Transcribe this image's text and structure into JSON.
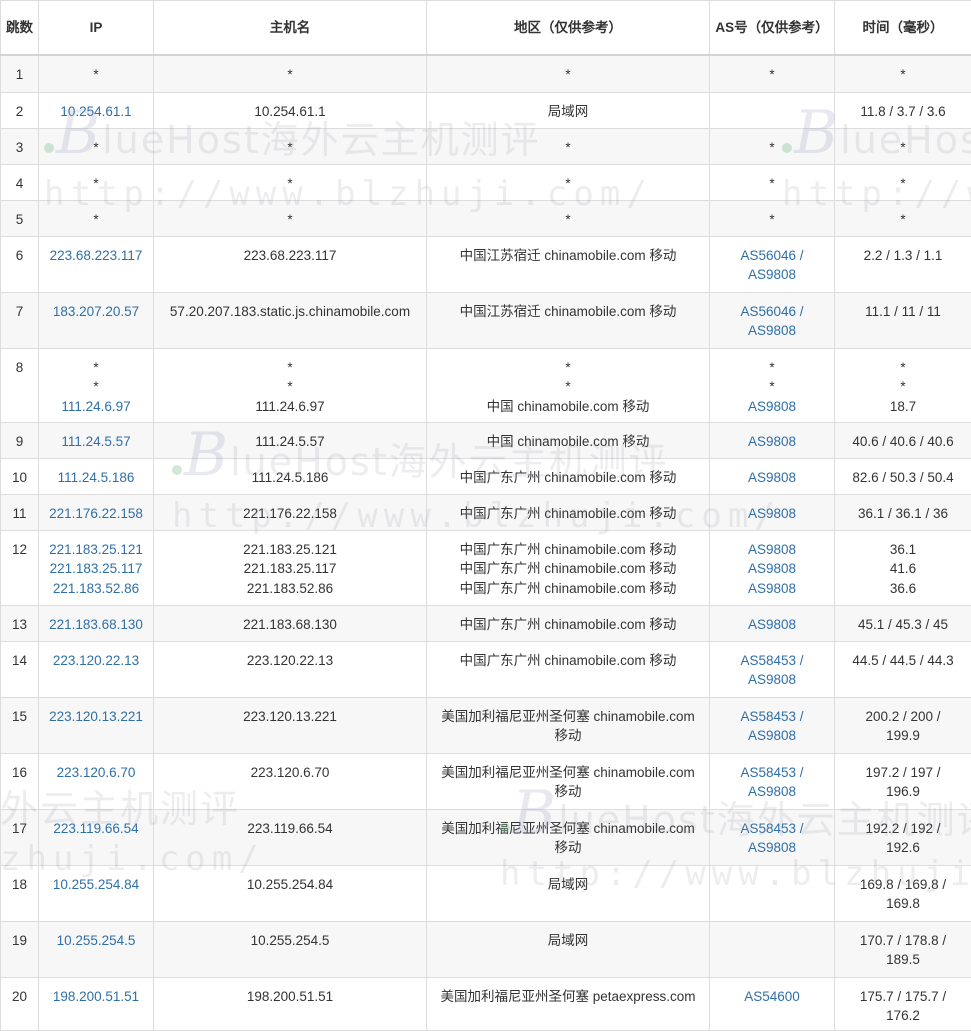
{
  "headers": {
    "hop": "跳数",
    "ip": "IP",
    "host": "主机名",
    "region": "地区（仅供参考）",
    "as": "AS号（仅供参考）",
    "time": "时间（毫秒）"
  },
  "rows": [
    {
      "hop": "1",
      "ips": [
        "*"
      ],
      "hosts": [
        "*"
      ],
      "regions": [
        "*"
      ],
      "as": [
        "*"
      ],
      "times": [
        "*"
      ]
    },
    {
      "hop": "2",
      "ips": [
        "10.254.61.1"
      ],
      "hosts": [
        "10.254.61.1"
      ],
      "regions": [
        "局域网"
      ],
      "as": [
        ""
      ],
      "times": [
        "11.8 / 3.7 / 3.6"
      ]
    },
    {
      "hop": "3",
      "ips": [
        "*"
      ],
      "hosts": [
        "*"
      ],
      "regions": [
        "*"
      ],
      "as": [
        "*"
      ],
      "times": [
        "*"
      ]
    },
    {
      "hop": "4",
      "ips": [
        "*"
      ],
      "hosts": [
        "*"
      ],
      "regions": [
        "*"
      ],
      "as": [
        "*"
      ],
      "times": [
        "*"
      ]
    },
    {
      "hop": "5",
      "ips": [
        "*"
      ],
      "hosts": [
        "*"
      ],
      "regions": [
        "*"
      ],
      "as": [
        "*"
      ],
      "times": [
        "*"
      ]
    },
    {
      "hop": "6",
      "ips": [
        "223.68.223.117"
      ],
      "hosts": [
        "223.68.223.117"
      ],
      "regions": [
        "中国江苏宿迁 chinamobile.com 移动"
      ],
      "as": [
        "AS56046 /",
        "AS9808"
      ],
      "times": [
        "2.2 / 1.3 / 1.1"
      ]
    },
    {
      "hop": "7",
      "ips": [
        "183.207.20.57"
      ],
      "hosts": [
        "57.20.207.183.static.js.chinamobile.com"
      ],
      "regions": [
        "中国江苏宿迁 chinamobile.com 移动"
      ],
      "as": [
        "AS56046 /",
        "AS9808"
      ],
      "times": [
        "11.1 / 11 / 11"
      ]
    },
    {
      "hop": "8",
      "ips": [
        "*",
        "*",
        "111.24.6.97"
      ],
      "hosts": [
        "*",
        "*",
        "111.24.6.97"
      ],
      "regions": [
        "*",
        "*",
        "中国 chinamobile.com 移动"
      ],
      "as": [
        "*",
        "*",
        "AS9808"
      ],
      "times": [
        "*",
        "*",
        "18.7"
      ]
    },
    {
      "hop": "9",
      "ips": [
        "111.24.5.57"
      ],
      "hosts": [
        "111.24.5.57"
      ],
      "regions": [
        "中国 chinamobile.com 移动"
      ],
      "as": [
        "AS9808"
      ],
      "times": [
        "40.6 / 40.6 / 40.6"
      ]
    },
    {
      "hop": "10",
      "ips": [
        "111.24.5.186"
      ],
      "hosts": [
        "111.24.5.186"
      ],
      "regions": [
        "中国广东广州 chinamobile.com 移动"
      ],
      "as": [
        "AS9808"
      ],
      "times": [
        "82.6 / 50.3 / 50.4"
      ]
    },
    {
      "hop": "11",
      "ips": [
        "221.176.22.158"
      ],
      "hosts": [
        "221.176.22.158"
      ],
      "regions": [
        "中国广东广州 chinamobile.com 移动"
      ],
      "as": [
        "AS9808"
      ],
      "times": [
        "36.1 / 36.1 / 36"
      ]
    },
    {
      "hop": "12",
      "ips": [
        "221.183.25.121",
        "221.183.25.117",
        "221.183.52.86"
      ],
      "hosts": [
        "221.183.25.121",
        "221.183.25.117",
        "221.183.52.86"
      ],
      "regions": [
        "中国广东广州 chinamobile.com 移动",
        "中国广东广州 chinamobile.com 移动",
        "中国广东广州 chinamobile.com 移动"
      ],
      "as": [
        "AS9808",
        "AS9808",
        "AS9808"
      ],
      "times": [
        "36.1",
        "41.6",
        "36.6"
      ]
    },
    {
      "hop": "13",
      "ips": [
        "221.183.68.130"
      ],
      "hosts": [
        "221.183.68.130"
      ],
      "regions": [
        "中国广东广州 chinamobile.com 移动"
      ],
      "as": [
        "AS9808"
      ],
      "times": [
        "45.1 / 45.3 / 45"
      ]
    },
    {
      "hop": "14",
      "ips": [
        "223.120.22.13"
      ],
      "hosts": [
        "223.120.22.13"
      ],
      "regions": [
        "中国广东广州 chinamobile.com 移动"
      ],
      "as": [
        "AS58453 /",
        "AS9808"
      ],
      "times": [
        "44.5 / 44.5 / 44.3"
      ]
    },
    {
      "hop": "15",
      "ips": [
        "223.120.13.221"
      ],
      "hosts": [
        "223.120.13.221"
      ],
      "regions": [
        "美国加利福尼亚州圣何塞 chinamobile.com",
        "移动"
      ],
      "as": [
        "AS58453 /",
        "AS9808"
      ],
      "times": [
        "200.2 / 200 /",
        "199.9"
      ]
    },
    {
      "hop": "16",
      "ips": [
        "223.120.6.70"
      ],
      "hosts": [
        "223.120.6.70"
      ],
      "regions": [
        "美国加利福尼亚州圣何塞 chinamobile.com",
        "移动"
      ],
      "as": [
        "AS58453 /",
        "AS9808"
      ],
      "times": [
        "197.2 / 197 /",
        "196.9"
      ]
    },
    {
      "hop": "17",
      "ips": [
        "223.119.66.54"
      ],
      "hosts": [
        "223.119.66.54"
      ],
      "regions": [
        "美国加利福尼亚州圣何塞 chinamobile.com",
        "移动"
      ],
      "as": [
        "AS58453 /",
        "AS9808"
      ],
      "times": [
        "192.2 / 192 /",
        "192.6"
      ]
    },
    {
      "hop": "18",
      "ips": [
        "10.255.254.84"
      ],
      "hosts": [
        "10.255.254.84"
      ],
      "regions": [
        "局域网"
      ],
      "as": [
        ""
      ],
      "times": [
        "169.8 / 169.8 /",
        "169.8"
      ]
    },
    {
      "hop": "19",
      "ips": [
        "10.255.254.5"
      ],
      "hosts": [
        "10.255.254.5"
      ],
      "regions": [
        "局域网"
      ],
      "as": [
        ""
      ],
      "times": [
        "170.7 / 178.8 /",
        "189.5"
      ]
    },
    {
      "hop": "20",
      "ips": [
        "198.200.51.51"
      ],
      "hosts": [
        "198.200.51.51"
      ],
      "regions": [
        "美国加利福尼亚州圣何塞 petaexpress.com"
      ],
      "as": [
        "AS54600"
      ],
      "times": [
        "175.7 / 175.7 /",
        "176.2"
      ]
    }
  ],
  "watermark": {
    "brand_initial": "B",
    "brand_text": "lueHost海外云主机测评",
    "url": "http://www.blzhuji.com/",
    "fragment_brand": "外云主机测评",
    "fragment_url": "zhuji.com/"
  }
}
